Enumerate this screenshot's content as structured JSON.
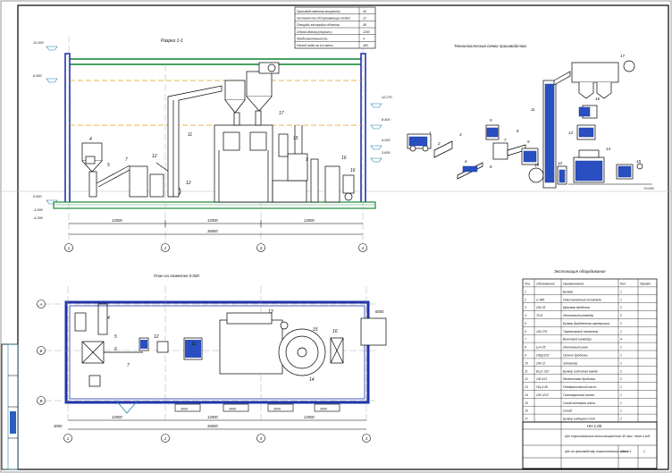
{
  "section": {
    "title": "Разрез 1-1",
    "levels": [
      "12.000",
      "8.300",
      "0.000",
      "-1.000",
      "-4.300"
    ],
    "right_levels": [
      "12.270",
      "8.400",
      "4.200",
      "3.600"
    ],
    "dims": [
      "12000",
      "12000",
      "12000",
      "36000"
    ],
    "axes": [
      "1",
      "2",
      "3",
      "4"
    ],
    "callouts": [
      "4",
      "5",
      "7",
      "12",
      "11",
      "12",
      "17",
      "15",
      "9",
      "16",
      "16"
    ]
  },
  "tech_scheme": {
    "title": "Технологическая схема производства",
    "level_mark": "+0.000",
    "callouts": [
      "1",
      "2",
      "3",
      "4",
      "5",
      "6",
      "7",
      "8",
      "9",
      "10",
      "11",
      "12",
      "13",
      "14",
      "15",
      "16",
      "17"
    ]
  },
  "plan": {
    "title": "План на отметке 0.000",
    "dims": [
      "12000",
      "12000",
      "12000",
      "36000",
      "6000",
      "3000"
    ],
    "room_marks": [
      "3000",
      "3000",
      "3000",
      "3000"
    ],
    "axes": [
      "1",
      "2",
      "3",
      "4",
      "А",
      "Б",
      "В"
    ],
    "callouts": [
      "4",
      "5",
      "6",
      "7",
      "12",
      "11",
      "13",
      "15",
      "16",
      "14"
    ]
  },
  "stats": {
    "rows": [
      {
        "label": "Производственная мощность",
        "value": "40"
      },
      {
        "label": "Численность обслуживающих людей",
        "value": "12"
      },
      {
        "label": "Площадь застройки объекта",
        "value": "48"
      },
      {
        "label": "Объем здания (строит.)",
        "value": "1200"
      },
      {
        "label": "Продолжительность",
        "value": "4"
      },
      {
        "label": "Расход воды на 1т смеси",
        "value": "400"
      }
    ]
  },
  "spec": {
    "title": "Экспликация оборудования",
    "headers": [
      "Поз.",
      "Обозначение",
      "Наименование",
      "Кол.",
      "Примеч."
    ],
    "rows": [
      [
        "1",
        "",
        "Бункер",
        "1"
      ],
      [
        "2",
        "С-945",
        "Пластинчатый питатель",
        "1"
      ],
      [
        "3",
        "СМ-33",
        "Щековая дробилка",
        "1"
      ],
      [
        "4",
        "ТЛ-6",
        "Ленточный конвейер",
        "2"
      ],
      [
        "5",
        "",
        "Бункер дробленного материала",
        "1"
      ],
      [
        "6",
        "СМ-279",
        "Тарельчатый питатель",
        "1"
      ],
      [
        "7",
        "",
        "Винтовой конвейер",
        "4"
      ],
      [
        "8",
        "Ц-4-25",
        "Ленточный шнек",
        "1"
      ],
      [
        "9",
        "СМД-102",
        "Грохот дробилки",
        "1"
      ],
      [
        "10",
        "СМ-12",
        "Элеватор",
        "1"
      ],
      [
        "11",
        "БЦ-1-110",
        "Бункер гипсового камня",
        "1"
      ],
      [
        "12",
        "СМ-413",
        "Молотковая дробилка",
        "2"
      ],
      [
        "13",
        "ПЦ-4-45",
        "Пневматический насос",
        "1"
      ],
      [
        "14",
        "СМ-1212",
        "Гипсоварочный котел",
        "1"
      ],
      [
        "15",
        "",
        "Склад готового гипса",
        "1"
      ],
      [
        "16",
        "",
        "Склад",
        "1"
      ],
      [
        "17",
        "",
        "Бункер кипящего слоя",
        "2"
      ]
    ]
  },
  "title_block": {
    "code": "НН 1.00",
    "project": "Цех строительного гипса мощностью 40 тыс. тонн в год",
    "drawing": "Цех по производству строительного гипса",
    "sheet": "Лист 1",
    "sheets": "1"
  }
}
